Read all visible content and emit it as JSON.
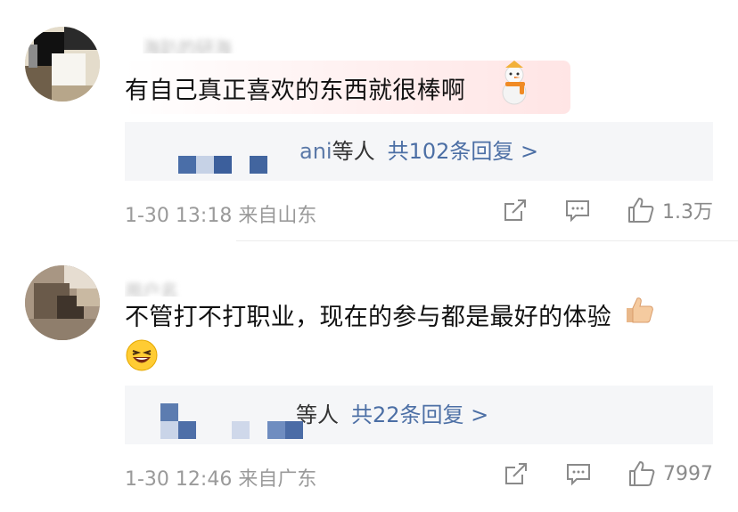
{
  "comments": [
    {
      "username": "海趴的研海",
      "text": "有自己真正喜欢的东西就很棒啊",
      "emoji": "snowman-sticker",
      "replies": {
        "name_tail": "ani",
        "deng": "等人",
        "link": "共102条回复 >"
      },
      "time": "1-30 13:18",
      "location": "来自山东",
      "likes": "1.3万"
    },
    {
      "username": "用户名",
      "text": "不管打不打职业，现在的参与都是最好的体验",
      "emoji": [
        "thumbs-up-emoji",
        "laughing-emoji"
      ],
      "replies": {
        "name_tail": "",
        "deng": "等人",
        "link": "共22条回复 >"
      },
      "time": "1-30 12:46",
      "location": "来自广东",
      "likes": "7997"
    }
  ],
  "icons": {
    "share": "share-icon",
    "comment": "comment-icon",
    "like": "thumbs-up-icon"
  },
  "colors": {
    "link": "#4c6fa5",
    "meta": "#9a9a9a",
    "reply_bg": "#f5f6f8"
  }
}
